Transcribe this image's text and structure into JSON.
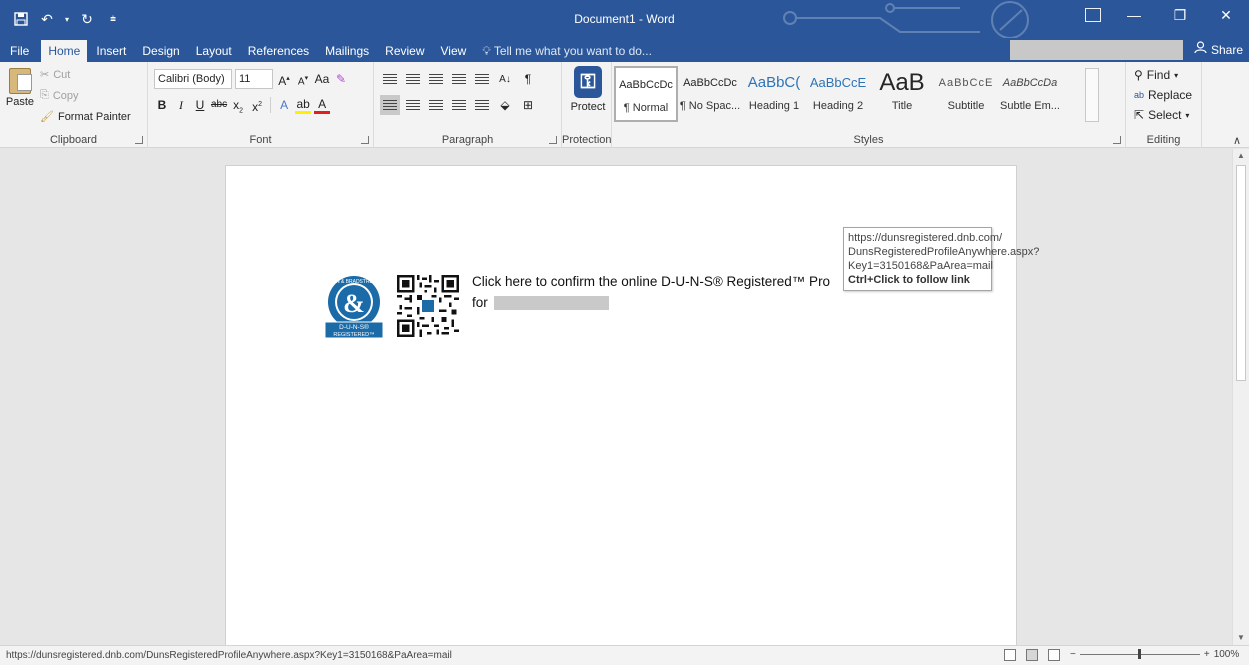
{
  "window": {
    "title": "Document1 - Word"
  },
  "qat": {
    "save_icon": "save-icon",
    "undo_icon": "undo-icon",
    "redo_icon": "redo-icon",
    "customize_icon": "customize-icon"
  },
  "tabs": [
    {
      "label": "File"
    },
    {
      "label": "Home"
    },
    {
      "label": "Insert"
    },
    {
      "label": "Design"
    },
    {
      "label": "Layout"
    },
    {
      "label": "References"
    },
    {
      "label": "Mailings"
    },
    {
      "label": "Review"
    },
    {
      "label": "View"
    }
  ],
  "tell_me": "Tell me what you want to do...",
  "share": "Share",
  "clipboard": {
    "paste": "Paste",
    "cut": "Cut",
    "copy": "Copy",
    "format_painter": "Format Painter",
    "label": "Clipboard"
  },
  "font": {
    "name": "Calibri (Body)",
    "size": "11",
    "label": "Font",
    "change_case": "Aa",
    "clear_formatting": "A"
  },
  "paragraph": {
    "label": "Paragraph"
  },
  "protection": {
    "protect": "Protect",
    "label": "Protection"
  },
  "styles": {
    "label": "Styles",
    "items": [
      {
        "sample": "AaBbCcDc",
        "name": "¶ Normal"
      },
      {
        "sample": "AaBbCcDc",
        "name": "¶ No Spac..."
      },
      {
        "sample": "AaBbC(",
        "name": "Heading 1"
      },
      {
        "sample": "AaBbCcE",
        "name": "Heading 2"
      },
      {
        "sample": "AaB",
        "name": "Title"
      },
      {
        "sample": "AaBbCcE",
        "name": "Subtitle"
      },
      {
        "sample": "AaBbCcDa",
        "name": "Subtle Em..."
      }
    ]
  },
  "editing": {
    "find": "Find",
    "replace": "Replace",
    "select": "Select",
    "label": "Editing"
  },
  "document": {
    "line1": "Click here to confirm the online D-U-N-S® Registered™ Pro",
    "line2": "for",
    "seal": {
      "ring_text": "DUN & BRADSTREET",
      "amp": "&",
      "banner1": "D-U-N-S®",
      "banner2": "REGISTERED™"
    }
  },
  "tooltip": {
    "url_line1": "https://dunsregistered.dnb.com/",
    "url_line2": "DunsRegisteredProfileAnywhere.aspx?",
    "url_line3": "Key1=3150168&PaArea=mail",
    "hint": "Ctrl+Click to follow link"
  },
  "statusbar": {
    "url": "https://dunsregistered.dnb.com/DunsRegisteredProfileAnywhere.aspx?Key1=3150168&PaArea=mail",
    "zoom": "100%"
  },
  "colors": {
    "accent": "#2b579a",
    "ribbon": "#f3f3f3",
    "canvas": "#e6e6e6"
  }
}
